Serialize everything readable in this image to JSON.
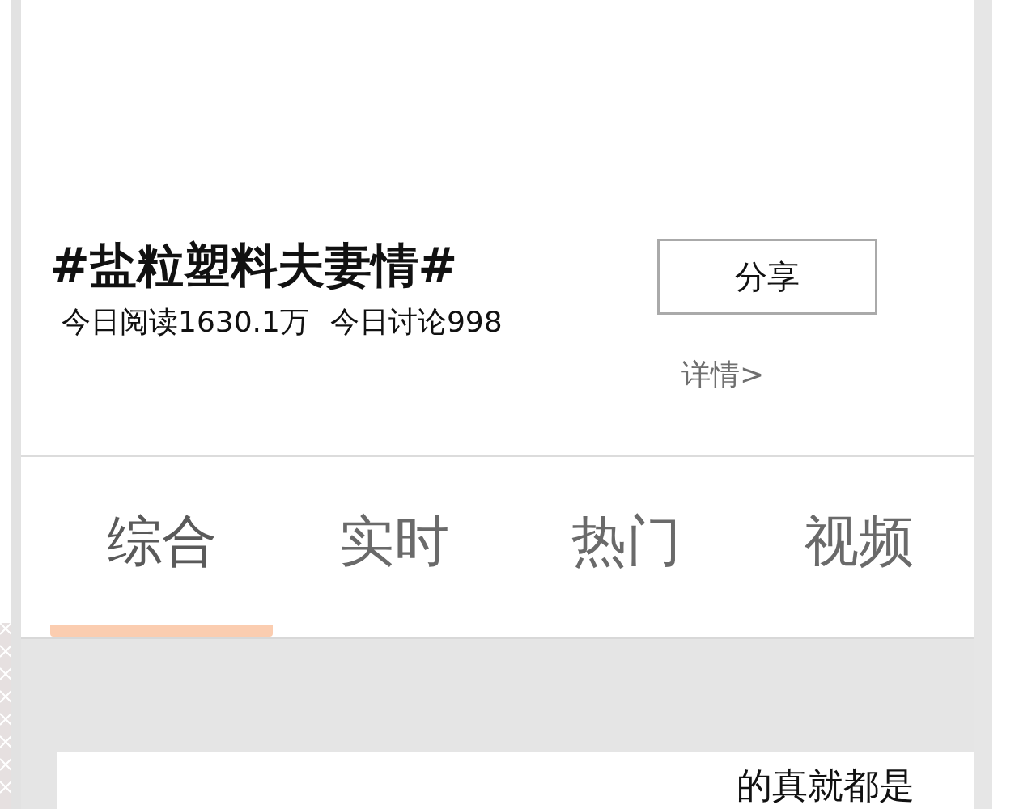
{
  "topic": {
    "title": "#盐粒塑料夫妻情#",
    "stats": [
      "今日阅读1630.1万",
      "今日讨论998"
    ],
    "share_button": "分享",
    "details_link": "详情>"
  },
  "tabs": [
    {
      "label": "综合",
      "selected": true
    },
    {
      "label": "实时",
      "selected": false
    },
    {
      "label": "热门",
      "selected": false
    },
    {
      "label": "视频",
      "selected": false
    }
  ],
  "post": {
    "text": "的真就都是"
  }
}
